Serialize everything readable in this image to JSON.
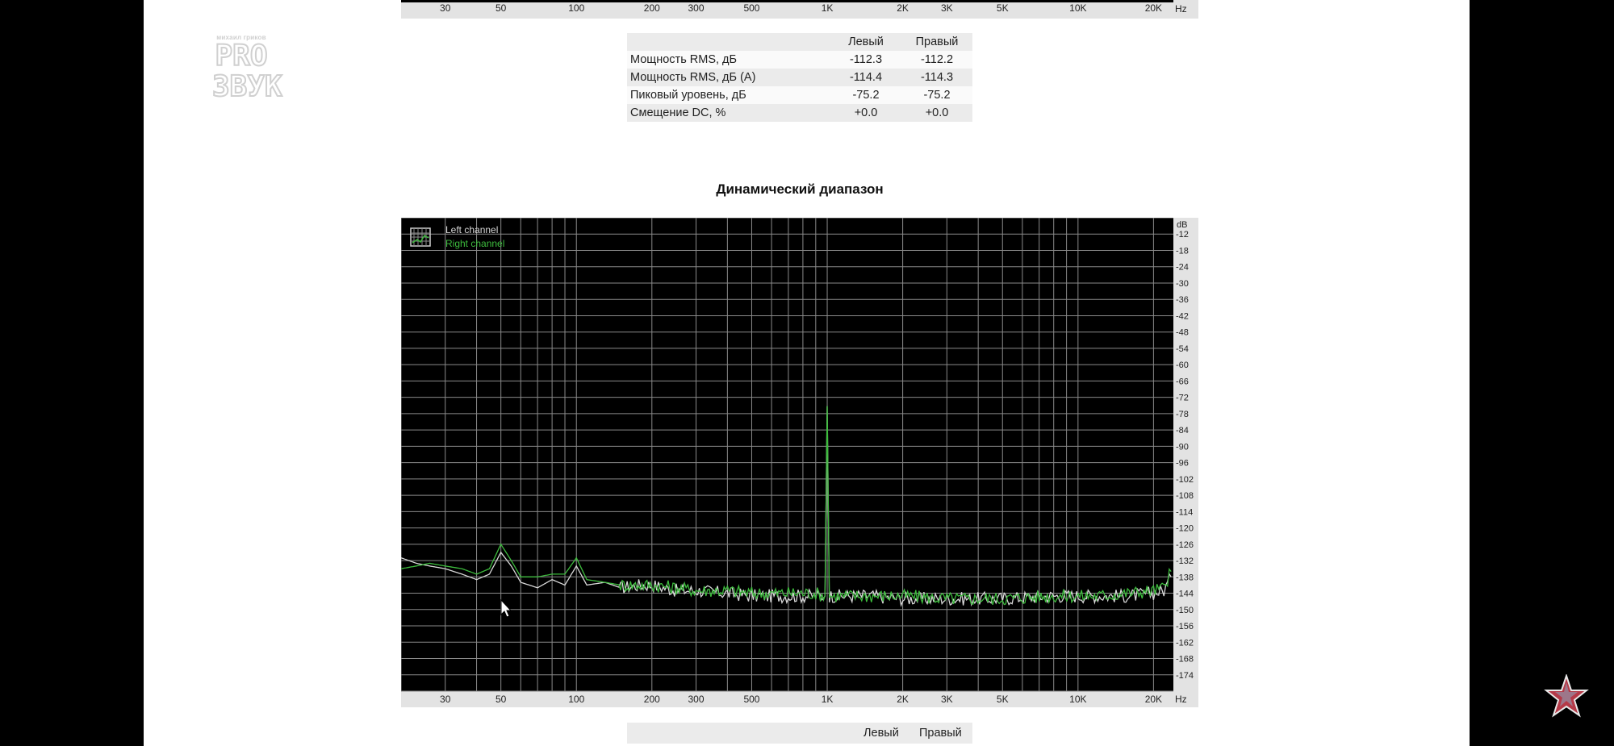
{
  "logo": {
    "small_text": "михаил гриков",
    "line1": "PRO",
    "line2": "ЗВУК"
  },
  "top_axis": {
    "ticks": [
      "30",
      "50",
      "100",
      "200",
      "300",
      "500",
      "1K",
      "2K",
      "3K",
      "5K",
      "10K",
      "20K"
    ],
    "unit": "Hz"
  },
  "stats_table": {
    "headers": [
      "",
      "Левый",
      "Правый"
    ],
    "rows": [
      [
        "Мощность RMS, дБ",
        "-112.3",
        "-112.2"
      ],
      [
        "Мощность RMS, дБ (A)",
        "-114.4",
        "-114.3"
      ],
      [
        "Пиковый уровень, дБ",
        "-75.2",
        "-75.2"
      ],
      [
        "Смещение DC, %",
        "+0.0",
        "+0.0"
      ]
    ]
  },
  "chart_title": "Динамический диапазон",
  "chart_data": {
    "type": "line",
    "title": "Динамический диапазон",
    "x_scale": "log",
    "xlim": [
      20,
      24000
    ],
    "ylim": [
      -180,
      -6
    ],
    "x_ticks": [
      {
        "v": 30,
        "label": "30"
      },
      {
        "v": 50,
        "label": "50"
      },
      {
        "v": 100,
        "label": "100"
      },
      {
        "v": 200,
        "label": "200"
      },
      {
        "v": 300,
        "label": "300"
      },
      {
        "v": 500,
        "label": "500"
      },
      {
        "v": 1000,
        "label": "1K"
      },
      {
        "v": 2000,
        "label": "2K"
      },
      {
        "v": 3000,
        "label": "3K"
      },
      {
        "v": 5000,
        "label": "5K"
      },
      {
        "v": 10000,
        "label": "10K"
      },
      {
        "v": 20000,
        "label": "20K"
      }
    ],
    "x_unit": "Hz",
    "y_unit": "dB",
    "y_ticks": [
      -12,
      -18,
      -24,
      -30,
      -36,
      -42,
      -48,
      -54,
      -60,
      -66,
      -72,
      -78,
      -84,
      -90,
      -96,
      -102,
      -108,
      -114,
      -120,
      -126,
      -132,
      -138,
      -144,
      -150,
      -156,
      -162,
      -168,
      -174
    ],
    "grid": true,
    "legend_position": "top-left",
    "background": "#000000",
    "series": [
      {
        "name": "Left channel",
        "color": "#d8d8d8",
        "x": [
          20,
          23,
          26,
          30,
          35,
          40,
          45,
          50,
          55,
          60,
          70,
          80,
          90,
          100,
          110,
          130,
          150,
          180,
          200,
          250,
          300,
          400,
          500,
          700,
          900,
          980,
          1000,
          1020,
          1100,
          1500,
          2000,
          3000,
          5000,
          8000,
          12000,
          16000,
          20000,
          22000,
          23500
        ],
        "y": [
          -131,
          -133,
          -134,
          -135,
          -137,
          -139,
          -137,
          -129,
          -134,
          -140,
          -142,
          -139,
          -141,
          -134,
          -141,
          -140,
          -142,
          -141,
          -141,
          -143,
          -143,
          -144,
          -145,
          -145,
          -145,
          -145,
          -75.2,
          -145,
          -145,
          -145,
          -146,
          -146,
          -146,
          -145,
          -145,
          -145,
          -144,
          -143,
          -138
        ]
      },
      {
        "name": "Right channel",
        "color": "#3dbb3d",
        "x": [
          20,
          23,
          26,
          30,
          35,
          40,
          45,
          50,
          55,
          60,
          70,
          80,
          90,
          100,
          110,
          130,
          150,
          180,
          200,
          250,
          300,
          400,
          500,
          700,
          900,
          980,
          1000,
          1020,
          1100,
          1500,
          2000,
          3000,
          5000,
          8000,
          12000,
          16000,
          20000,
          22000,
          23500
        ],
        "y": [
          -135,
          -134,
          -133,
          -134,
          -135,
          -137,
          -135,
          -126,
          -132,
          -138,
          -138,
          -137,
          -137,
          -131,
          -139,
          -140,
          -141,
          -141,
          -141,
          -142,
          -143,
          -143,
          -144,
          -144,
          -144,
          -145,
          -75.2,
          -145,
          -145,
          -145,
          -145,
          -146,
          -146,
          -145,
          -145,
          -144,
          -143,
          -142,
          -136
        ]
      }
    ]
  },
  "bottom_table": {
    "headers": [
      "Левый",
      "Правый"
    ]
  },
  "colors": {
    "grid": "#8a8a8a",
    "left_channel": "#d8d8d8",
    "right_channel": "#3dbb3d",
    "star": "#b53a48"
  },
  "icons": {
    "legend": "grid-legend-icon",
    "star": "star-icon"
  }
}
